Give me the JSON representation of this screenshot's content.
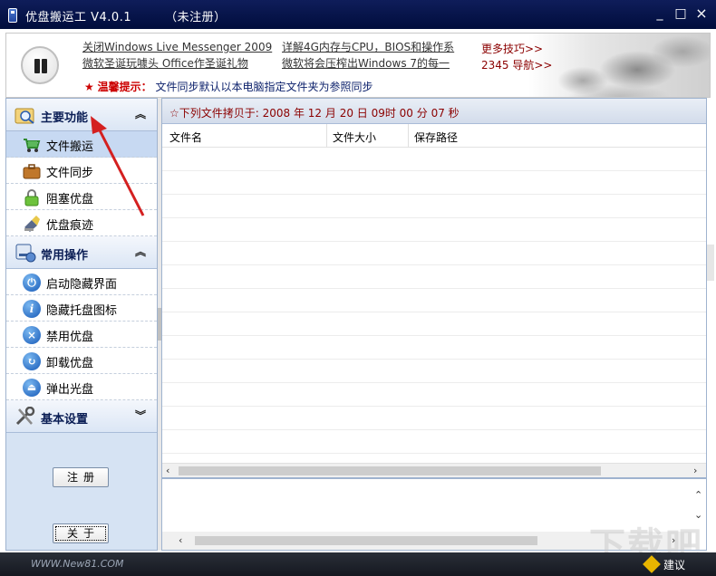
{
  "window": {
    "title": "优盘搬运工 V4.0.1        （未注册）",
    "minimize": "_",
    "maximize": "□",
    "close": "×"
  },
  "header": {
    "news": [
      "关闭Windows Live Messenger 2009",
      "微软圣诞玩噱头 Office作圣诞礼物",
      "详解4G内存与CPU，BIOS和操作系",
      "微软将会压榨出Windows 7的每一"
    ],
    "more_tips": "更多技巧>>",
    "nav_2345": "2345 导航>>",
    "tip_label": "温馨提示：",
    "tip_text": "文件同步默认以本电脑指定文件夹为参照同步"
  },
  "sidebar": {
    "sections": [
      {
        "label": "主要功能",
        "chevron": "⌃⌃"
      },
      {
        "label": "常用操作",
        "chevron": "⌃⌃"
      },
      {
        "label": "基本设置",
        "chevron": "⌄⌄"
      }
    ],
    "main_items": [
      {
        "label": "文件搬运",
        "icon": "cart-icon"
      },
      {
        "label": "文件同步",
        "icon": "briefcase-icon"
      },
      {
        "label": "阻塞优盘",
        "icon": "lock-icon"
      },
      {
        "label": "优盘痕迹",
        "icon": "clean-icon"
      }
    ],
    "common_items": [
      {
        "label": "启动隐藏界面",
        "glyph": "⏻"
      },
      {
        "label": "隐藏托盘图标",
        "glyph": "i"
      },
      {
        "label": "禁用优盘",
        "glyph": "×"
      },
      {
        "label": "卸载优盘",
        "glyph": "↻"
      },
      {
        "label": "弹出光盘",
        "glyph": "⏏"
      }
    ],
    "register_button": "注册",
    "about_button": "关于"
  },
  "main": {
    "heading": "下列文件拷贝于:  2008 年 12 月 20 日 09时 00 分 07 秒",
    "star": "☆",
    "columns": [
      "文件名",
      "文件大小",
      "保存路径"
    ]
  },
  "statusbar": {
    "watermark": "WWW.New81.COM",
    "suggest": "建议"
  },
  "colors": {
    "title_bar": "#0f1d5a",
    "sidebar_bg": "#d6e3f3",
    "accent_red": "#c00000"
  }
}
